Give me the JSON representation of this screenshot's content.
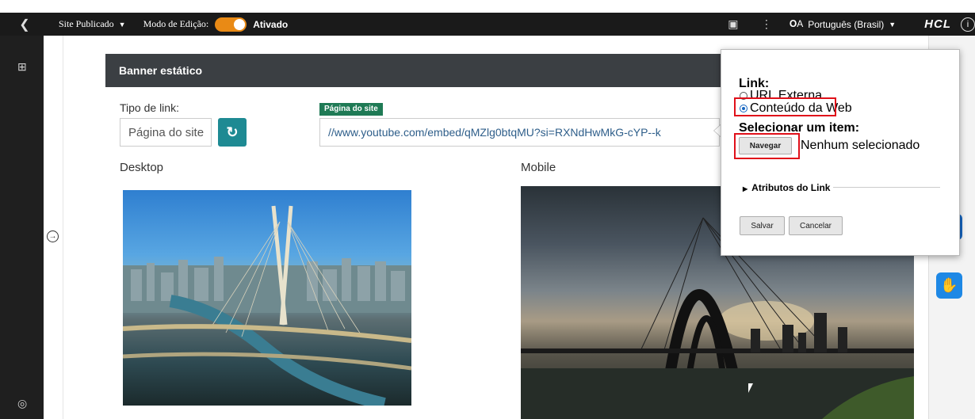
{
  "topbar": {
    "back_icon": "chevron-left-icon",
    "site_published": "Site Publicado",
    "edit_mode_label": "Modo de Edição:",
    "edit_mode_state": "Ativado",
    "language": "Português (Brasil)",
    "brand": "HCL",
    "toggle_color": "#e98a15"
  },
  "panel": {
    "title": "Banner estático",
    "link_type_label": "Tipo de link:",
    "link_type_value": "Página do site",
    "site_page_badge": "Página do site",
    "url_value": "//www.youtube.com/embed/qMZlg0btqMU?si=RXNdHwMkG-cYP--k",
    "desktop_label": "Desktop",
    "mobile_label": "Mobile"
  },
  "popup": {
    "link_label": "Link:",
    "option_external": "URL Externa",
    "option_web": "Conteúdo da Web",
    "select_label": "Selecionar um item:",
    "browse_button": "Navegar",
    "none_selected": "Nenhum selecionado",
    "attributes_label": "Atributos do Link",
    "save_button": "Salvar",
    "cancel_button": "Cancelar",
    "highlight_color": "#e0101a"
  },
  "colors": {
    "panel_header": "#3b3f43",
    "refresh_button": "#1e8a93",
    "badge": "#1f7a55",
    "accessibility": "#1565c0"
  }
}
